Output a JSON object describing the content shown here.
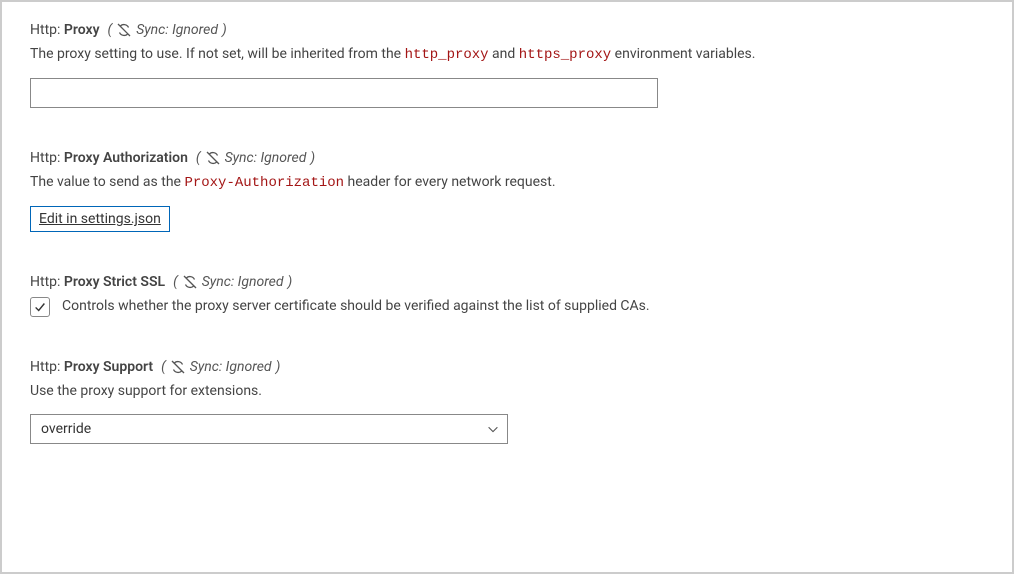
{
  "sync_label": "Sync: Ignored",
  "settings": {
    "proxy": {
      "category": "Http:",
      "name": "Proxy",
      "description_prefix": "The proxy setting to use. If not set, will be inherited from the ",
      "code1": "http_proxy",
      "description_mid": " and ",
      "code2": "https_proxy",
      "description_suffix": " environment variables.",
      "value": ""
    },
    "proxy_auth": {
      "category": "Http:",
      "name": "Proxy Authorization",
      "description_prefix": "The value to send as the ",
      "code1": "Proxy-Authorization",
      "description_suffix": " header for every network request.",
      "link_label": "Edit in settings.json"
    },
    "proxy_strict_ssl": {
      "category": "Http:",
      "name": "Proxy Strict SSL",
      "checked": true,
      "description": "Controls whether the proxy server certificate should be verified against the list of supplied CAs."
    },
    "proxy_support": {
      "category": "Http:",
      "name": "Proxy Support",
      "description": "Use the proxy support for extensions.",
      "value": "override"
    }
  }
}
